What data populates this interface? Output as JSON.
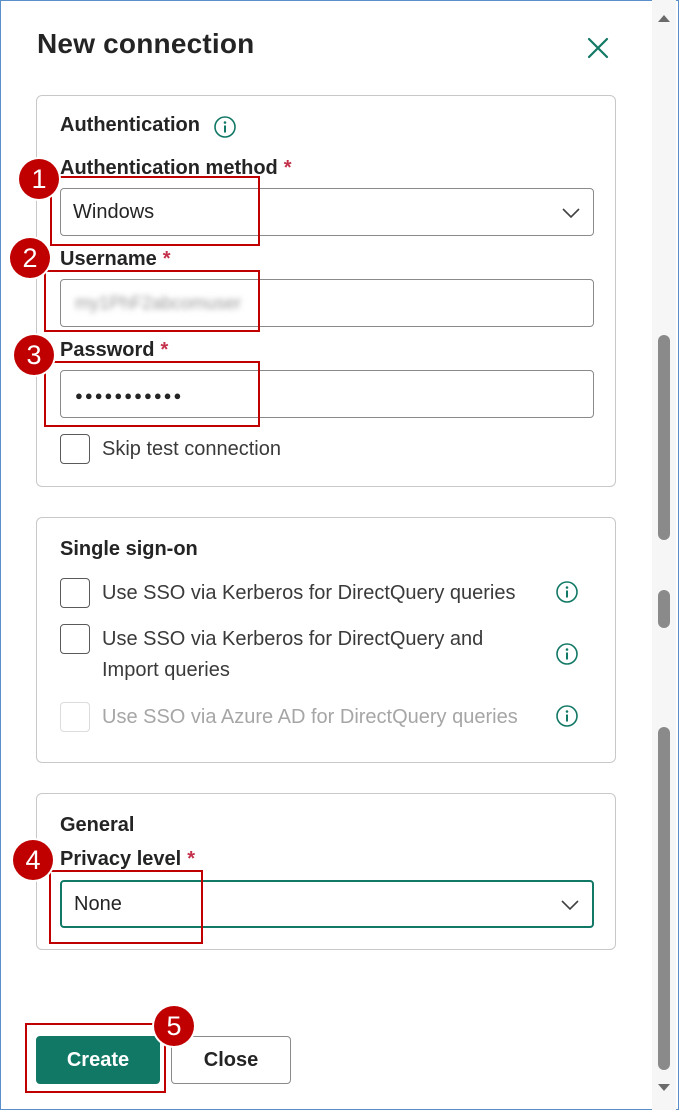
{
  "dialog": {
    "title": "New connection"
  },
  "authentication": {
    "section_title": "Authentication",
    "method_label": "Authentication method",
    "method_value": "Windows",
    "username_label": "Username",
    "username_value": "my1PhF2abcomuser",
    "password_label": "Password",
    "password_value": "●●●●●●●●●●●",
    "skip_test_label": "Skip test connection"
  },
  "required_marker": "*",
  "sso": {
    "section_title": "Single sign-on",
    "options": [
      {
        "label": "Use SSO via Kerberos for DirectQuery queries",
        "enabled": true
      },
      {
        "label": "Use SSO via Kerberos for DirectQuery and Import queries",
        "enabled": true
      },
      {
        "label": "Use SSO via Azure AD for DirectQuery queries",
        "enabled": false
      }
    ]
  },
  "general": {
    "section_title": "General",
    "privacy_label": "Privacy level",
    "privacy_value": "None"
  },
  "footer": {
    "create_label": "Create",
    "close_label": "Close"
  },
  "annotations": [
    "1",
    "2",
    "3",
    "4",
    "5"
  ],
  "colors": {
    "accent": "#117865",
    "required": "#c4314b",
    "callout": "#c00000"
  },
  "icons": [
    "close-icon",
    "info-icon",
    "chevron-down-icon"
  ]
}
